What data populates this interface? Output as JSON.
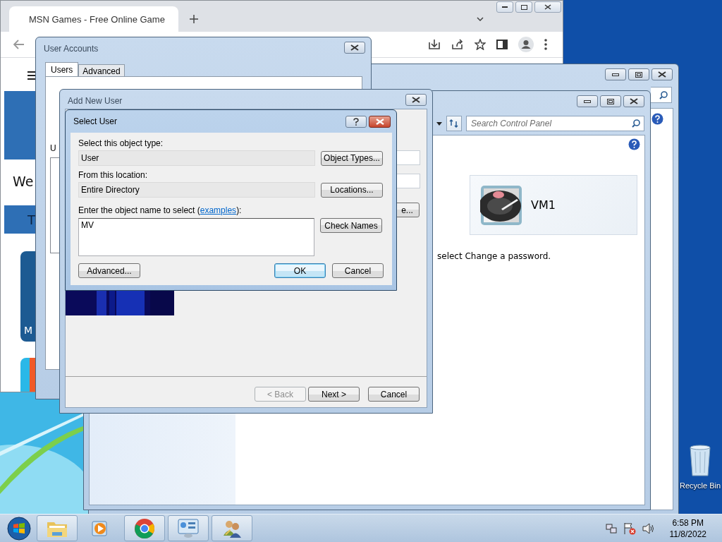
{
  "browser": {
    "tab": {
      "title": "MSN Games - Free Online Game",
      "selected": true
    },
    "page": [
      {
        "kind": "heading",
        "text": "We"
      },
      {
        "kind": "banner",
        "text": "T"
      },
      {
        "kind": "tile",
        "text": "M"
      }
    ]
  },
  "control_panel": {
    "search": {
      "placeholder": "Search Control Panel"
    },
    "account": {
      "name": "VM1"
    },
    "instruction": "select Change a password."
  },
  "user_accounts": {
    "title": "User Accounts",
    "tabs": [
      {
        "label": "Users",
        "selected": true
      },
      {
        "label": "Advanced",
        "selected": false
      }
    ],
    "label": "U"
  },
  "add_new_user": {
    "title": "Add New User",
    "side_button": "e...",
    "buttons": [
      {
        "label": "< Back",
        "disabled": true
      },
      {
        "label": "Next >",
        "disabled": false
      },
      {
        "label": "Cancel",
        "disabled": false
      }
    ]
  },
  "select_user": {
    "title": "Select User",
    "type_label": "Select this object type:",
    "type_value": "User",
    "type_button": "Object Types...",
    "location_label": "From this location:",
    "location_value": "Entire Directory",
    "location_button": "Locations...",
    "prompt_before": "Enter the object name to select (",
    "prompt_link": "examples",
    "prompt_after": "):",
    "names": "MV",
    "check_button": "Check Names",
    "buttons": [
      {
        "label": "Advanced...",
        "default": false
      },
      {
        "label": "OK",
        "default": true
      },
      {
        "label": "Cancel",
        "default": false
      }
    ]
  },
  "taskbar": {
    "apps": [
      {
        "kind": "folder",
        "running": true
      },
      {
        "kind": "player",
        "running": false
      },
      {
        "kind": "browser",
        "running": true
      },
      {
        "kind": "panel",
        "running": true
      },
      {
        "kind": "users",
        "running": true
      }
    ],
    "clock": {
      "time": "6:58 PM",
      "date": "11/8/2022"
    }
  },
  "desktop": {
    "icons": [
      {
        "label": "Recycle Bin"
      }
    ]
  }
}
